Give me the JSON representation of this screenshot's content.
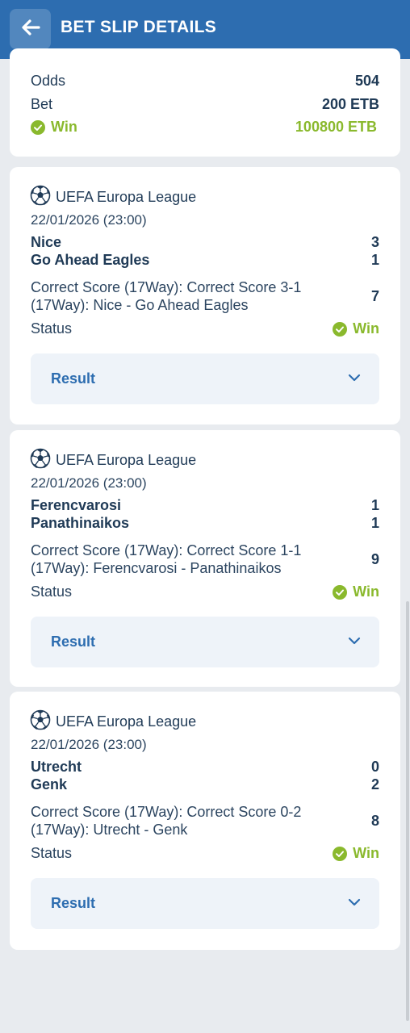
{
  "header": {
    "title": "BET SLIP DETAILS",
    "back_icon": "arrow-left-icon"
  },
  "summary": {
    "odds_label": "Odds",
    "odds_value": "504",
    "bet_label": "Bet",
    "bet_value": "200 ETB",
    "win_label": "Win",
    "win_value": "100800 ETB"
  },
  "colors": {
    "header": "#2d6db0",
    "win": "#8ab92d",
    "text": "#1f3a56",
    "result_bg": "#eef3f9"
  },
  "selections": [
    {
      "league": "UEFA Europa League",
      "date": "22/01/2026 (23:00)",
      "home_team": "Nice",
      "home_score": "3",
      "away_team": "Go Ahead Eagles",
      "away_score": "1",
      "market_line1": "Correct Score (17Way): Correct Score 3-1",
      "market_line2": "(17Way): Nice - Go Ahead Eagles",
      "odd": "7",
      "status_label": "Status",
      "status_value": "Win",
      "result_label": "Result"
    },
    {
      "league": "UEFA Europa League",
      "date": "22/01/2026 (23:00)",
      "home_team": "Ferencvarosi",
      "home_score": "1",
      "away_team": "Panathinaikos",
      "away_score": "1",
      "market_line1": "Correct Score (17Way): Correct Score 1-1",
      "market_line2": "(17Way): Ferencvarosi - Panathinaikos",
      "odd": "9",
      "status_label": "Status",
      "status_value": "Win",
      "result_label": "Result"
    },
    {
      "league": "UEFA Europa League",
      "date": "22/01/2026 (23:00)",
      "home_team": "Utrecht",
      "home_score": "0",
      "away_team": "Genk",
      "away_score": "2",
      "market_line1": "Correct Score (17Way): Correct Score 0-2",
      "market_line2": "(17Way): Utrecht - Genk",
      "odd": "8",
      "status_label": "Status",
      "status_value": "Win",
      "result_label": "Result"
    }
  ]
}
